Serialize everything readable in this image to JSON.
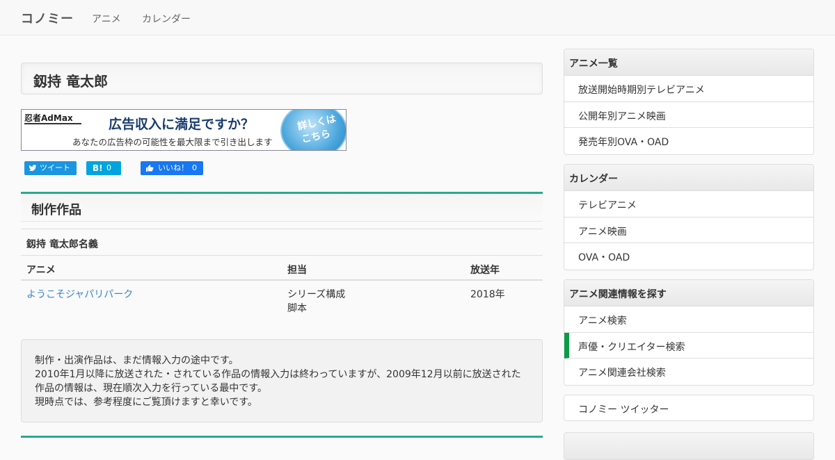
{
  "navbar": {
    "brand": "コノミー",
    "links": [
      "アニメ",
      "カレンダー"
    ]
  },
  "page": {
    "title": "釼持 竜太郎"
  },
  "ad": {
    "logo": "忍者AdMax",
    "headline": "広告収入に満足ですか？",
    "sub": "あなたの広告枠の可能性を最大限まで引き出します",
    "badge_line1": "詳しくは",
    "badge_line2": "こちら"
  },
  "share": {
    "tweet": "ツイート",
    "hatena_mark": "B!",
    "hatena_count": "0",
    "like": "いいね！",
    "like_count": "0"
  },
  "works": {
    "heading": "制作作品",
    "credit_name": "釼持 竜太郎名義",
    "columns": [
      "アニメ",
      "担当",
      "放送年"
    ],
    "rows": [
      {
        "title": "ようこそジャパリパーク",
        "roles": [
          "シリーズ構成",
          "脚本"
        ],
        "year": "2018年"
      }
    ]
  },
  "notice": {
    "lines": [
      "制作・出演作品は、まだ情報入力の途中です。",
      "2010年1月以降に放送された・されている作品の情報入力は終わっていますが、2009年12月以前に放送された作品の情報は、現在順次入力を行っている最中です。",
      "現時点では、参考程度にご覧頂けますと幸いです。"
    ]
  },
  "sidebar": {
    "panels": [
      {
        "heading": "アニメ一覧",
        "items": [
          "放送開始時期別テレビアニメ",
          "公開年別アニメ映画",
          "発売年別OVA・OAD"
        ]
      },
      {
        "heading": "カレンダー",
        "items": [
          "テレビアニメ",
          "アニメ映画",
          "OVA・OAD"
        ]
      },
      {
        "heading": "アニメ関連情報を探す",
        "items": [
          "アニメ検索",
          "声優・クリエイター検索",
          "アニメ関連会社検索"
        ],
        "active_index": 1
      },
      {
        "heading": "",
        "items": [
          "コノミー ツイッター"
        ]
      }
    ]
  },
  "colors": {
    "accent": "#2aaa8a",
    "active_marker": "#0b9a47",
    "link": "#3a87c8"
  }
}
